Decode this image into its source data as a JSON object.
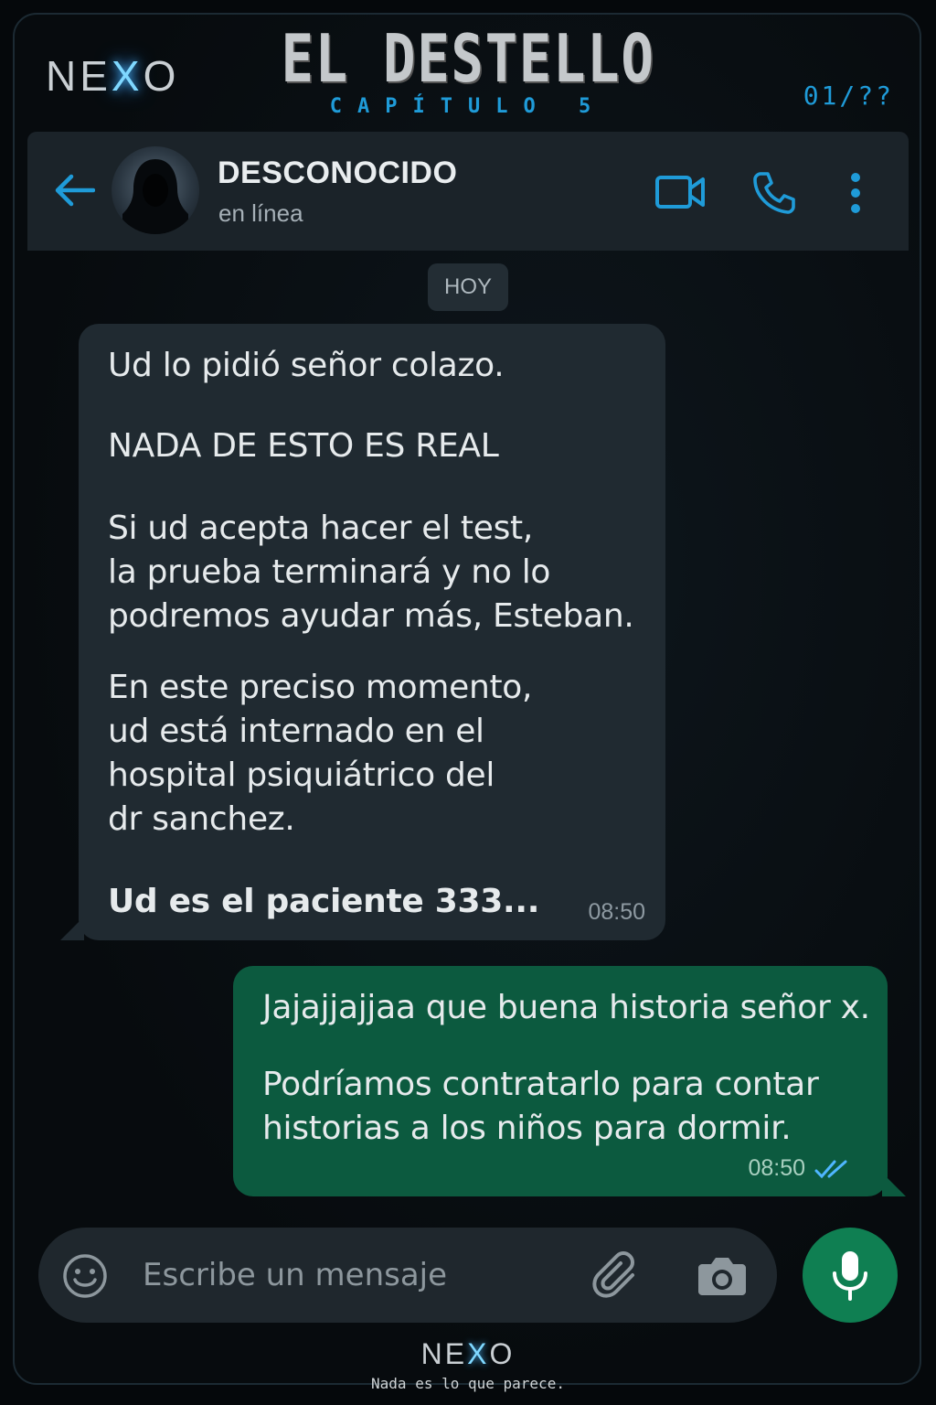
{
  "branding": {
    "logo_left": "NE",
    "logo_x": "X",
    "logo_right": "O",
    "title": "EL DESTELLO",
    "chapter": "CAPÍTULO 5",
    "counter": "01/??",
    "tagline": "Nada es lo que parece."
  },
  "chat_header": {
    "contact_name": "DESCONOCIDO",
    "status": "en línea",
    "icons": [
      "arrow-left-icon",
      "video-icon",
      "phone-icon",
      "more-vertical-icon"
    ],
    "accent_color": "#1f9bd8"
  },
  "date_chip": "HOY",
  "messages": [
    {
      "direction": "incoming",
      "lines": [
        "Ud lo pidió señor colazo.",
        "NADA DE ESTO ES REAL",
        "Si ud acepta hacer el test,",
        "la prueba terminará y no lo",
        "podremos ayudar más, Esteban.",
        "En este preciso momento,",
        "ud está internado en el",
        "hospital psiquiátrico del",
        "dr sanchez.",
        "Ud es el paciente 333..."
      ],
      "time": "08:50"
    },
    {
      "direction": "outgoing",
      "lines": [
        "Jajajjajjaa que buena historia señor x.",
        "Podríamos contratarlo para contar",
        "historias a los niños para dormir."
      ],
      "time": "08:50",
      "status": "read"
    }
  ],
  "composer": {
    "placeholder": "Escribe un mensaje",
    "icons": [
      "emoji-icon",
      "paperclip-icon",
      "camera-icon",
      "microphone-icon"
    ],
    "send_color": "#0f7f52"
  },
  "colors": {
    "incoming_bubble": "#202a31",
    "outgoing_bubble": "#0c5a3f",
    "header_bg": "#1b2329"
  }
}
